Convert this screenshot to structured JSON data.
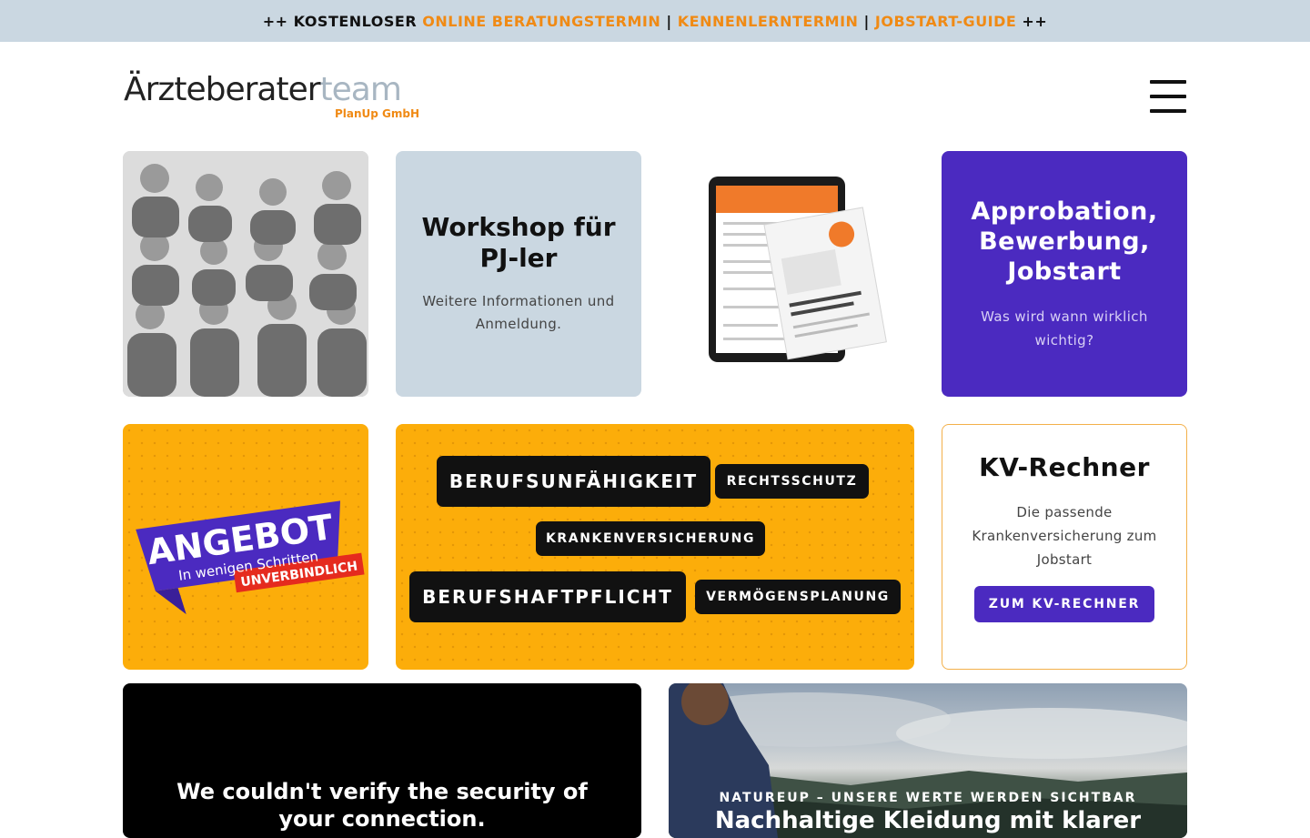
{
  "topbar": {
    "prefix": "++ KOSTENLOSER ",
    "link1": "ONLINE BERATUNGSTERMIN",
    "sep1": " | ",
    "link2": "KENNENLERNTERMIN",
    "sep2": " | ",
    "link3": "JOBSTART-GUIDE",
    "suffix": " ++"
  },
  "logo": {
    "main_dark": "Ärzteberater",
    "main_light": "team",
    "sub": "PlanUp GmbH"
  },
  "menu": {
    "icon": "hamburger-menu-icon"
  },
  "cards": {
    "workshop": {
      "title": "Workshop für PJ-ler",
      "text": "Weitere Informationen und Anmeldung."
    },
    "approbation": {
      "title": "Approbation, Bewerbung, Jobstart",
      "text": "Was wird wann wirklich wichtig?"
    },
    "angebot": {
      "title": "ANGEBOT",
      "subtitle": "In wenigen Schritten",
      "badge": "UNVERBINDLICH"
    },
    "tags": [
      "BERUFSUNFÄHIGKEIT",
      "RECHTSSCHUTZ",
      "KRANKENVERSICHERUNG",
      "BERUFSHAFTPFLICHT",
      "VERMÖGENSPLANUNG"
    ],
    "kv": {
      "title": "KV-Rechner",
      "text": "Die passende Krankenversicherung zum Jobstart",
      "button": "ZUM KV-RECHNER"
    },
    "video": {
      "message": "We couldn't verify the security of your connection."
    },
    "nature": {
      "kicker": "NATUREUP – UNSERE WERTE WERDEN SICHTBAR",
      "headline": "Nachhaltige Kleidung mit klarer"
    }
  },
  "colors": {
    "topbar_bg": "#cad7e1",
    "accent_orange": "#f08a14",
    "purple": "#4b2ac0",
    "yellow": "#fcad0a"
  }
}
